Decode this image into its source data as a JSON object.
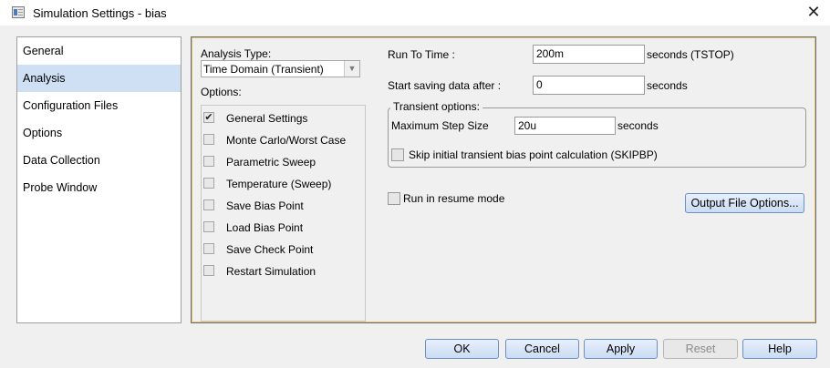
{
  "window": {
    "title": "Simulation Settings - bias",
    "close_glyph": "✕"
  },
  "nav": {
    "items": [
      {
        "label": "General"
      },
      {
        "label": "Analysis"
      },
      {
        "label": "Configuration Files"
      },
      {
        "label": "Options"
      },
      {
        "label": "Data Collection"
      },
      {
        "label": "Probe Window"
      }
    ],
    "selected": "Analysis"
  },
  "analysis": {
    "type_label": "Analysis Type:",
    "type_value": "Time Domain (Transient)",
    "options_label": "Options:",
    "options": [
      {
        "label": "General Settings",
        "checked": true
      },
      {
        "label": "Monte Carlo/Worst Case",
        "checked": false
      },
      {
        "label": "Parametric Sweep",
        "checked": false
      },
      {
        "label": "Temperature (Sweep)",
        "checked": false
      },
      {
        "label": "Save Bias Point",
        "checked": false
      },
      {
        "label": "Load Bias Point",
        "checked": false
      },
      {
        "label": "Save Check Point",
        "checked": false
      },
      {
        "label": "Restart Simulation",
        "checked": false
      }
    ],
    "check_glyph": "✔"
  },
  "transient": {
    "run_to_time_label": "Run To Time :",
    "run_to_time_value": "200m",
    "run_to_time_unit": "seconds (TSTOP)",
    "start_saving_label": "Start saving data after :",
    "start_saving_value": "0",
    "start_saving_unit": "seconds",
    "group_title": "Transient options:",
    "max_step_label": "Maximum Step Size",
    "max_step_value": "20u",
    "max_step_unit": "seconds",
    "skip_bias_label": "Skip initial transient bias point calculation (SKIPBP)",
    "skip_bias_checked": false,
    "resume_label": "Run in resume mode",
    "resume_checked": false,
    "output_file_button": "Output File Options..."
  },
  "footer": {
    "ok": "OK",
    "cancel": "Cancel",
    "apply": "Apply",
    "reset": "Reset",
    "help": "Help"
  }
}
